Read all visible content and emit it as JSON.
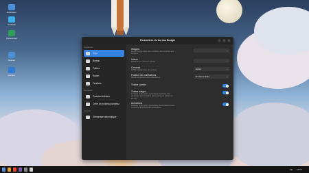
{
  "desktop": {
    "icons": [
      {
        "name": "computer-icon",
        "label": "Ordinateur",
        "color": "#4a90d9"
      },
      {
        "name": "trash-icon",
        "label": "Corbeille",
        "color": "#3daee9"
      },
      {
        "name": "settings-icon",
        "label": "Paramètres",
        "color": "#2f9e5a"
      },
      {
        "name": "home-icon",
        "label": "Dossier",
        "color": "#4a90d9"
      },
      {
        "name": "vlc-icon",
        "label": "Lecteur",
        "color": "#2e7bd1"
      }
    ]
  },
  "window": {
    "title": "Paramètres du bureau Budgie",
    "sidebar": {
      "section_appearance": "Apparence",
      "items": [
        {
          "label": "Style",
          "icon": "palette-icon",
          "selected": true
        },
        {
          "label": "Bureau",
          "icon": "desktop-icon",
          "selected": false
        },
        {
          "label": "Polices",
          "icon": "font-icon",
          "selected": false
        },
        {
          "label": "Raven",
          "icon": "raven-icon",
          "selected": false
        },
        {
          "label": "Fenêtres",
          "icon": "windows-icon",
          "selected": false
        }
      ],
      "section_panels": "Panneaux",
      "panel_items": [
        {
          "label": "Panneau inférieur",
          "icon": "panel-icon"
        },
        {
          "label": "Créer un nouveau panneau",
          "icon": "add-icon"
        }
      ],
      "section_session": "Session",
      "session_items": [
        {
          "label": "Démarrage automatique",
          "icon": "autostart-icon"
        }
      ]
    },
    "main": {
      "widgets": {
        "title": "Widgets",
        "desc": "Définir l'apparence des contrôles des fenêtres des fenêtres"
      },
      "icons": {
        "title": "Icônes",
        "desc": "Définir le jeu d'icônes global"
      },
      "cursors": {
        "title": "Curseurs",
        "desc": "Définir l'apparence du curseur",
        "value": "Défaut"
      },
      "notif_pos": {
        "title": "Position des notifications",
        "desc": "Définir la position des notifications",
        "value": "En haut à droite"
      },
      "dark_theme": {
        "title": "Thème sombre",
        "on": true
      },
      "builtin_theme": {
        "title": "Thème intégré",
        "desc": "Lorsque cette option est activée, le thème des panneaux est remplacé par le style par défaut du bureau",
        "on": true
      },
      "animations": {
        "title": "Animations",
        "desc": "Lorsque cette option est activée, les fenêtres et les contrôles disposent des animations",
        "on": true
      }
    }
  },
  "taskbar": {
    "apps": [
      {
        "name": "app-menu-icon",
        "color": "#5a8fd8"
      },
      {
        "name": "files-icon",
        "color": "#e0a33a"
      },
      {
        "name": "browser-icon",
        "color": "#e8452c"
      },
      {
        "name": "terminal-icon",
        "color": "#7b5ca8"
      },
      {
        "name": "settings-app-icon",
        "color": "#888888"
      }
    ],
    "tray_time": "16:55",
    "tray_text": "FR"
  }
}
